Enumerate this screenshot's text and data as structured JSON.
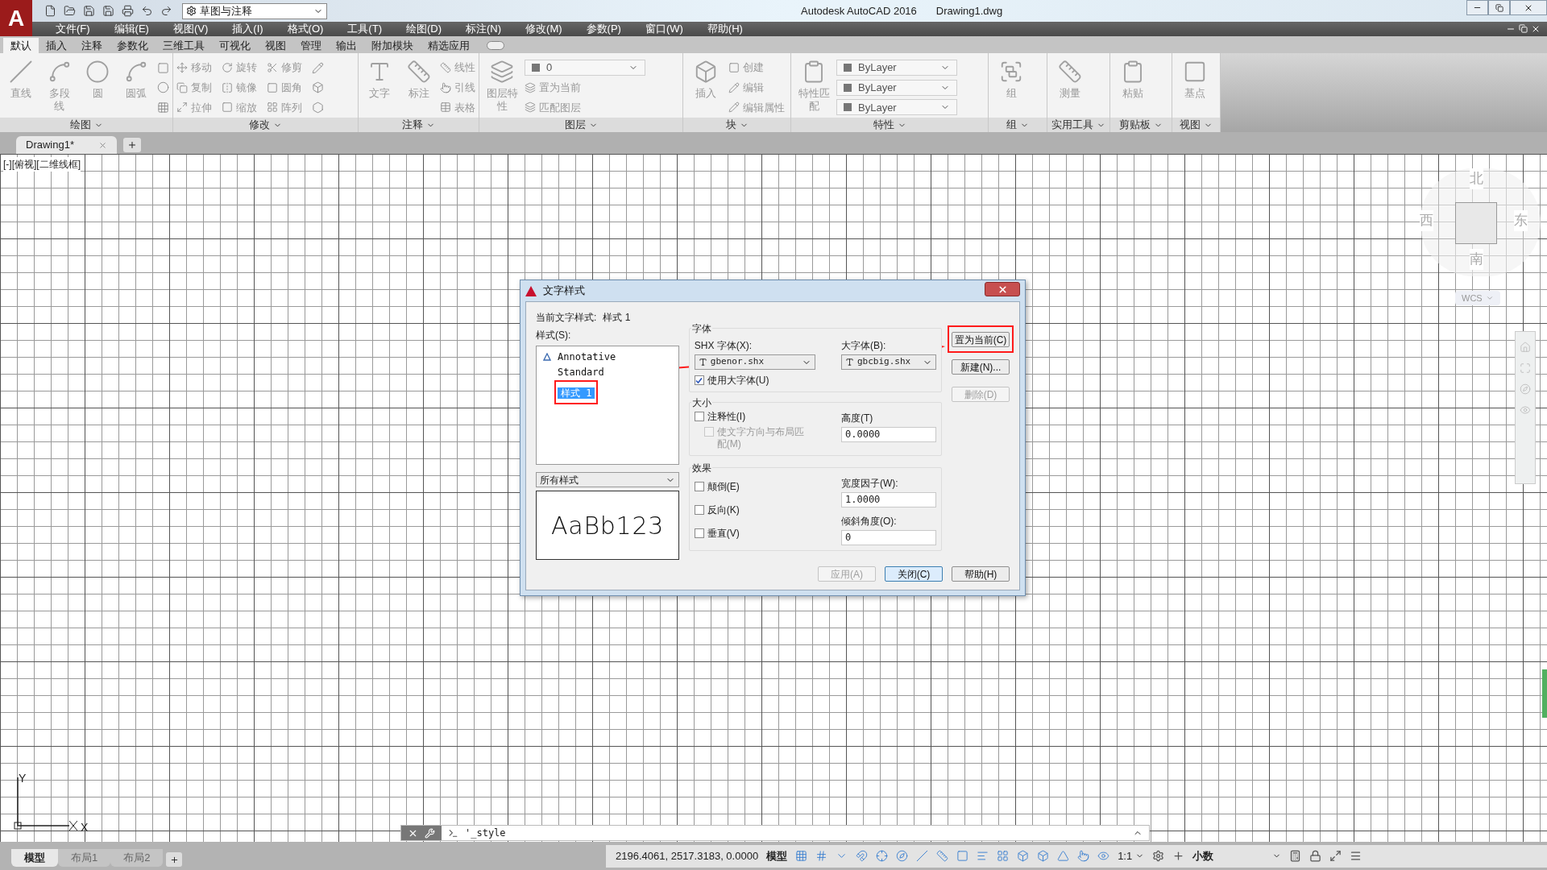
{
  "app": {
    "logo": "A",
    "workspace": "草图与注释",
    "title": "Autodesk AutoCAD 2016",
    "file": "Drawing1.dwg"
  },
  "menu": [
    "文件(F)",
    "编辑(E)",
    "视图(V)",
    "插入(I)",
    "格式(O)",
    "工具(T)",
    "绘图(D)",
    "标注(N)",
    "修改(M)",
    "参数(P)",
    "窗口(W)",
    "帮助(H)"
  ],
  "ribbon_tabs": [
    {
      "label": "默认",
      "selected": true
    },
    {
      "label": "插入",
      "selected": false
    },
    {
      "label": "注释",
      "selected": false
    },
    {
      "label": "参数化",
      "selected": false
    },
    {
      "label": "三维工具",
      "selected": false
    },
    {
      "label": "可视化",
      "selected": false
    },
    {
      "label": "视图",
      "selected": false
    },
    {
      "label": "管理",
      "selected": false
    },
    {
      "label": "输出",
      "selected": false
    },
    {
      "label": "附加模块",
      "selected": false
    },
    {
      "label": "精选应用",
      "selected": false
    }
  ],
  "ribbon_panels": [
    {
      "title": "绘图",
      "tools": [
        {
          "kind": "large",
          "label": "直线"
        },
        {
          "kind": "large",
          "label": "多段线"
        },
        {
          "kind": "large",
          "label": "圆"
        },
        {
          "kind": "large",
          "label": "圆弧"
        },
        {
          "kind": "icon"
        },
        {
          "kind": "icon"
        },
        {
          "kind": "icon"
        }
      ]
    },
    {
      "title": "修改",
      "tools": [
        {
          "kind": "small",
          "label": "移动"
        },
        {
          "kind": "small",
          "label": "复制"
        },
        {
          "kind": "small",
          "label": "拉伸"
        },
        {
          "kind": "small",
          "label": "旋转"
        },
        {
          "kind": "small",
          "label": "镜像"
        },
        {
          "kind": "small",
          "label": "缩放"
        },
        {
          "kind": "small",
          "label": "修剪"
        },
        {
          "kind": "small",
          "label": "圆角"
        },
        {
          "kind": "small",
          "label": "阵列"
        },
        {
          "kind": "icon"
        },
        {
          "kind": "icon"
        },
        {
          "kind": "icon"
        }
      ]
    },
    {
      "title": "注释",
      "tools": [
        {
          "kind": "large",
          "label": "文字"
        },
        {
          "kind": "large",
          "label": "标注"
        },
        {
          "kind": "small",
          "label": "线性"
        },
        {
          "kind": "small",
          "label": "引线"
        },
        {
          "kind": "small",
          "label": "表格"
        }
      ]
    },
    {
      "title": "图层",
      "tools": [
        {
          "kind": "large",
          "label": "图层特性"
        },
        {
          "kind": "dropdown",
          "label": "0"
        },
        {
          "kind": "small",
          "label": "置为当前"
        },
        {
          "kind": "small",
          "label": "匹配图层"
        }
      ]
    },
    {
      "title": "块",
      "tools": [
        {
          "kind": "large",
          "label": "插入"
        },
        {
          "kind": "small",
          "label": "创建"
        },
        {
          "kind": "small",
          "label": "编辑"
        },
        {
          "kind": "small",
          "label": "编辑属性"
        }
      ]
    },
    {
      "title": "特性",
      "tools": [
        {
          "kind": "large",
          "label": "特性匹配"
        },
        {
          "kind": "dropdown",
          "label": "ByLayer"
        },
        {
          "kind": "dropdown",
          "label": "ByLayer"
        },
        {
          "kind": "dropdown",
          "label": "ByLayer"
        }
      ]
    },
    {
      "title": "组",
      "tools": [
        {
          "kind": "large",
          "label": "组"
        }
      ]
    },
    {
      "title": "实用工具",
      "tools": [
        {
          "kind": "large",
          "label": "测量"
        }
      ]
    },
    {
      "title": "剪贴板",
      "tools": [
        {
          "kind": "large",
          "label": "粘贴"
        }
      ]
    },
    {
      "title": "视图",
      "tools": [
        {
          "kind": "large",
          "label": "基点"
        }
      ]
    }
  ],
  "document_tabs": [
    {
      "label": "Drawing1*",
      "selected": true
    }
  ],
  "viewport_label": "[-][俯视][二维线框]",
  "viewcube": {
    "north": "北",
    "west": "西",
    "east": "东",
    "south": "南",
    "ucs": "WCS"
  },
  "ucs_icon": {
    "y": "Y",
    "x": "X"
  },
  "dialog": {
    "title": "文字样式",
    "current_label": "当前文字样式:",
    "current_value": "样式 1",
    "styles_label": "样式(S):",
    "styles": [
      {
        "name": "Annotative",
        "annotative": true,
        "selected": false
      },
      {
        "name": "Standard",
        "annotative": false,
        "selected": false
      },
      {
        "name": "样式 1",
        "annotative": false,
        "selected": true
      }
    ],
    "filter": "所有样式",
    "preview": "AaBb123",
    "font_group": "字体",
    "shx_label": "SHX 字体(X):",
    "shx_value": "gbenor.shx",
    "bigfont_label": "大字体(B):",
    "bigfont_value": "gbcbig.shx",
    "use_bigfont": {
      "label": "使用大字体(U)",
      "checked": true
    },
    "size_group": "大小",
    "annotative": {
      "label": "注释性(I)",
      "checked": false
    },
    "match_layout": {
      "label": "使文字方向与布局匹配(M)",
      "checked": false,
      "disabled": true
    },
    "height_label": "高度(T)",
    "height_value": "0.0000",
    "effects_group": "效果",
    "effects": [
      {
        "label": "颠倒(E)",
        "checked": false
      },
      {
        "label": "反向(K)",
        "checked": false
      },
      {
        "label": "垂直(V)",
        "checked": false
      }
    ],
    "width_label": "宽度因子(W):",
    "width_value": "1.0000",
    "oblique_label": "倾斜角度(O):",
    "oblique_value": "0",
    "side_buttons": [
      {
        "label": "置为当前(C)",
        "disabled": false,
        "highlighted": true
      },
      {
        "label": "新建(N)...",
        "disabled": false,
        "highlighted": false
      },
      {
        "label": "删除(D)",
        "disabled": true,
        "highlighted": false
      }
    ],
    "bottom_buttons": [
      {
        "label": "应用(A)",
        "disabled": true,
        "default": false
      },
      {
        "label": "关闭(C)",
        "disabled": false,
        "default": true
      },
      {
        "label": "帮助(H)",
        "disabled": false,
        "default": false
      }
    ]
  },
  "command_line": {
    "value": "'_style"
  },
  "layout_tabs": [
    {
      "label": "模型",
      "selected": true
    },
    {
      "label": "布局1",
      "selected": false
    },
    {
      "label": "布局2",
      "selected": false
    }
  ],
  "status": {
    "coordinates": "2196.4061, 2517.3183, 0.0000",
    "space": "模型",
    "scale": "1:1",
    "units": "小数"
  }
}
